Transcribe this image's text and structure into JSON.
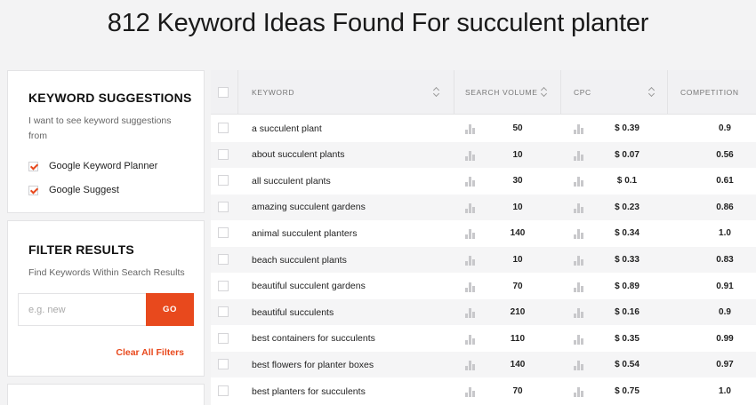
{
  "header": {
    "count": "812",
    "title_text": "Keyword Ideas Found For",
    "query": "succulent planter"
  },
  "suggestions_panel": {
    "title": "KEYWORD SUGGESTIONS",
    "description": "I want to see keyword suggestions from",
    "sources": [
      {
        "label": "Google Keyword Planner",
        "checked": true
      },
      {
        "label": "Google Suggest",
        "checked": true
      }
    ]
  },
  "filter_panel": {
    "title": "FILTER RESULTS",
    "description": "Find Keywords Within Search Results",
    "input_value": "",
    "input_placeholder": "e.g. new",
    "go_label": "GO",
    "clear_label": "Clear All Filters"
  },
  "table": {
    "columns": [
      "KEYWORD",
      "SEARCH VOLUME",
      "CPC",
      "COMPETITION"
    ],
    "rows": [
      {
        "keyword": "a succulent plant",
        "volume": "50",
        "cpc": "$ 0.39",
        "competition": "0.9"
      },
      {
        "keyword": "about succulent plants",
        "volume": "10",
        "cpc": "$ 0.07",
        "competition": "0.56"
      },
      {
        "keyword": "all succulent plants",
        "volume": "30",
        "cpc": "$ 0.1",
        "competition": "0.61"
      },
      {
        "keyword": "amazing succulent gardens",
        "volume": "10",
        "cpc": "$ 0.23",
        "competition": "0.86"
      },
      {
        "keyword": "animal succulent planters",
        "volume": "140",
        "cpc": "$ 0.34",
        "competition": "1.0"
      },
      {
        "keyword": "beach succulent plants",
        "volume": "10",
        "cpc": "$ 0.33",
        "competition": "0.83"
      },
      {
        "keyword": "beautiful succulent gardens",
        "volume": "70",
        "cpc": "$ 0.89",
        "competition": "0.91"
      },
      {
        "keyword": "beautiful succulents",
        "volume": "210",
        "cpc": "$ 0.16",
        "competition": "0.9"
      },
      {
        "keyword": "best containers for succulents",
        "volume": "110",
        "cpc": "$ 0.35",
        "competition": "0.99"
      },
      {
        "keyword": "best flowers for planter boxes",
        "volume": "140",
        "cpc": "$ 0.54",
        "competition": "0.97"
      },
      {
        "keyword": "best planters for succulents",
        "volume": "70",
        "cpc": "$ 0.75",
        "competition": "1.0"
      }
    ]
  },
  "icons": {
    "sort": "sort-icon",
    "volume_trend": "bar-chart-icon",
    "cpc_trend": "bar-chart-icon",
    "checkbox_checked": "checkmark-icon"
  },
  "colors": {
    "accent": "#e8491d",
    "header_bg": "#f1f1f3",
    "row_alt_bg": "#f5f5f6",
    "page_bg": "#f3f3f4"
  }
}
